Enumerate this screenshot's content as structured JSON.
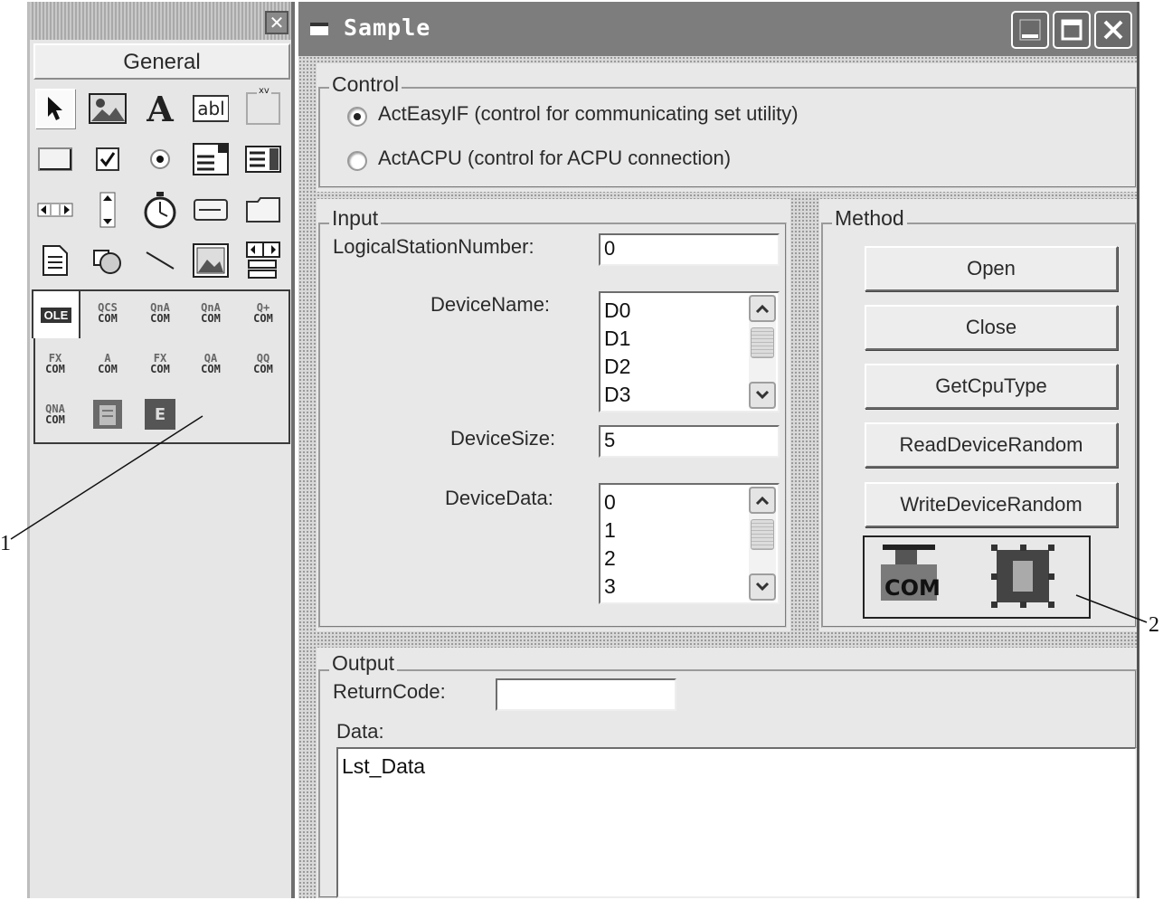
{
  "toolbox": {
    "close_glyph": "✕",
    "tab_label": "General",
    "standard_tools": [
      {
        "name": "pointer",
        "icon": "arrow-icon"
      },
      {
        "name": "picturebox",
        "icon": "picture-icon"
      },
      {
        "name": "label",
        "icon": "label-A-icon",
        "glyph": "A"
      },
      {
        "name": "textbox",
        "icon": "textbox-icon",
        "glyph": "abl"
      },
      {
        "name": "frame",
        "icon": "frame-icon",
        "glyph": "xv"
      },
      {
        "name": "commandbutton",
        "icon": "button-icon"
      },
      {
        "name": "checkbox",
        "icon": "checkbox-icon"
      },
      {
        "name": "optionbutton",
        "icon": "radio-icon"
      },
      {
        "name": "combobox",
        "icon": "combobox-icon"
      },
      {
        "name": "listbox",
        "icon": "listbox-icon"
      },
      {
        "name": "hscrollbar",
        "icon": "hscroll-icon"
      },
      {
        "name": "vscrollbar",
        "icon": "vscroll-icon"
      },
      {
        "name": "timer",
        "icon": "timer-icon"
      },
      {
        "name": "drivelistbox",
        "icon": "drive-icon"
      },
      {
        "name": "dirlistbox",
        "icon": "folder-icon"
      },
      {
        "name": "filelistbox",
        "icon": "file-icon"
      },
      {
        "name": "shape",
        "icon": "shape-icon"
      },
      {
        "name": "line",
        "icon": "line-icon"
      },
      {
        "name": "image",
        "icon": "image-icon"
      },
      {
        "name": "data",
        "icon": "data-icon"
      }
    ],
    "ole_label": "OLE",
    "com_tools": [
      {
        "top": "QCS",
        "bottom": "COM"
      },
      {
        "top": "QnA",
        "bottom": "COM"
      },
      {
        "top": "QnA",
        "bottom": "COM"
      },
      {
        "top": "Q+",
        "bottom": "COM"
      },
      {
        "top": "FX",
        "bottom": "COM"
      },
      {
        "top": "A",
        "bottom": "COM"
      },
      {
        "top": "FX",
        "bottom": "COM"
      },
      {
        "top": "QA",
        "bottom": "COM"
      },
      {
        "top": "QQ",
        "bottom": "COM"
      },
      {
        "top": "QNA",
        "bottom": "COM"
      }
    ],
    "extra_tools": [
      {
        "icon": "actutl-icon"
      },
      {
        "icon": "easy-if-icon",
        "glyph": "E"
      }
    ]
  },
  "window": {
    "title": "Sample"
  },
  "control": {
    "legend": "Control",
    "options": [
      {
        "label": "ActEasyIF (control for communicating set utility)",
        "checked": true
      },
      {
        "label": "ActACPU (control for ACPU connection)",
        "checked": false
      }
    ]
  },
  "input": {
    "legend": "Input",
    "logical_station_label": "LogicalStationNumber:",
    "logical_station_value": "0",
    "device_name_label": "DeviceName:",
    "device_name_items": [
      "D0",
      "D1",
      "D2",
      "D3"
    ],
    "device_size_label": "DeviceSize:",
    "device_size_value": "5",
    "device_data_label": "DeviceData:",
    "device_data_items": [
      "0",
      "1",
      "2",
      "3"
    ]
  },
  "method": {
    "legend": "Method",
    "buttons": [
      "Open",
      "Close",
      "GetCpuType",
      "ReadDeviceRandom",
      "WriteDeviceRandom"
    ]
  },
  "output": {
    "legend": "Output",
    "return_code_label": "ReturnCode:",
    "return_code_value": "",
    "data_label": "Data:",
    "data_list_name": "Lst_Data"
  },
  "annotations": {
    "callout_1": "1",
    "callout_2": "2"
  }
}
